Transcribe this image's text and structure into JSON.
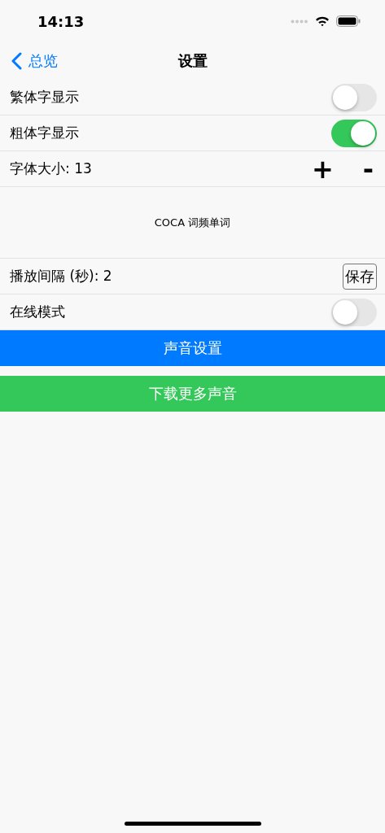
{
  "status_bar": {
    "time": "14:13"
  },
  "nav": {
    "back": "总览",
    "title": "设置"
  },
  "rows": [
    {
      "kind": "toggle",
      "label": "繁体字显示",
      "on": false
    },
    {
      "kind": "toggle",
      "label": "粗体字显示",
      "on": true
    },
    {
      "kind": "stepper",
      "label": "字体大小: 13",
      "plus": "+",
      "minus": "-"
    },
    {
      "kind": "preview",
      "label": "COCA 词频单词"
    },
    {
      "kind": "save",
      "label": "播放间隔 (秒):  2",
      "button": "保存"
    },
    {
      "kind": "toggle",
      "label": "在线模式",
      "on": false
    }
  ],
  "buttons": [
    {
      "label": "声音设置",
      "color": "#007aff"
    },
    {
      "label": "下载更多声音",
      "color": "#34c759"
    }
  ]
}
